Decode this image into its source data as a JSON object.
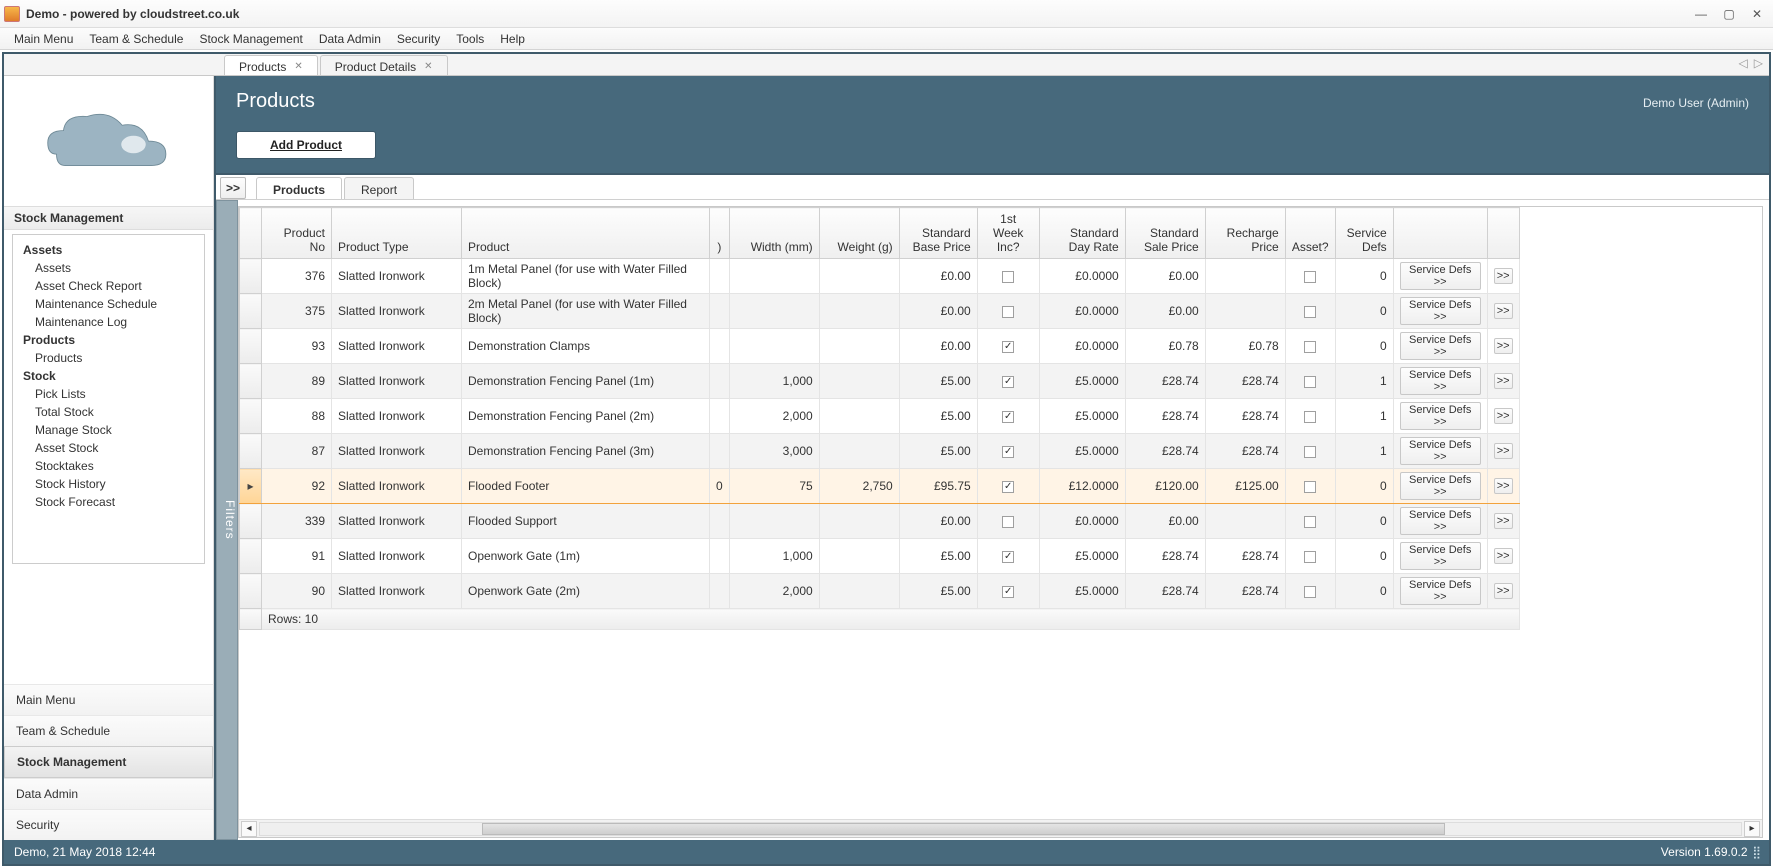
{
  "window": {
    "title": "Demo - powered by cloudstreet.co.uk"
  },
  "menubar": [
    "Main Menu",
    "Team & Schedule",
    "Stock Management",
    "Data Admin",
    "Security",
    "Tools",
    "Help"
  ],
  "tabs": [
    {
      "label": "Products",
      "active": true
    },
    {
      "label": "Product Details",
      "active": false
    }
  ],
  "page": {
    "title": "Products",
    "user": "Demo User (Admin)",
    "add_label": "Add Product"
  },
  "sidebar": {
    "section_title": "Stock Management",
    "groups": [
      {
        "cat": "Assets",
        "items": [
          "Assets",
          "Asset Check Report",
          "Maintenance Schedule",
          "Maintenance Log"
        ]
      },
      {
        "cat": "Products",
        "items": [
          "Products"
        ]
      },
      {
        "cat": "Stock",
        "items": [
          "Pick Lists",
          "Total Stock",
          "Manage Stock",
          "Asset Stock",
          "Stocktakes",
          "Stock History",
          "Stock Forecast"
        ]
      }
    ],
    "navbuttons": [
      "Main Menu",
      "Team & Schedule",
      "Stock Management",
      "Data Admin",
      "Security"
    ],
    "active_nav": "Stock Management"
  },
  "subtabs": [
    {
      "label": "Products",
      "active": true
    },
    {
      "label": "Report",
      "active": false
    }
  ],
  "expand_label": ">>",
  "filters_label": "Filters",
  "grid": {
    "columns": [
      "Product No",
      "Product Type",
      "Product",
      ")",
      "Width (mm)",
      "Weight (g)",
      "Standard Base Price",
      "1st Week Inc?",
      "Standard Day Rate",
      "Standard Sale Price",
      "Recharge Price",
      "Asset?",
      "Service Defs",
      "",
      ""
    ],
    "service_btn_label": "Service Defs >>",
    "more_btn_label": ">>",
    "rows": [
      {
        "no": "376",
        "type": "Slatted Ironwork",
        "product": "1m Metal Panel (for use with Water Filled Block)",
        "paren": "",
        "width": "",
        "weight": "",
        "base": "£0.00",
        "inc": false,
        "day": "£0.0000",
        "sale": "£0.00",
        "recharge": "",
        "asset": false,
        "defs": "0"
      },
      {
        "no": "375",
        "type": "Slatted Ironwork",
        "product": "2m Metal Panel (for use with Water Filled Block)",
        "paren": "",
        "width": "",
        "weight": "",
        "base": "£0.00",
        "inc": false,
        "day": "£0.0000",
        "sale": "£0.00",
        "recharge": "",
        "asset": false,
        "defs": "0"
      },
      {
        "no": "93",
        "type": "Slatted Ironwork",
        "product": "Demonstration Clamps",
        "paren": "",
        "width": "",
        "weight": "",
        "base": "£0.00",
        "inc": true,
        "day": "£0.0000",
        "sale": "£0.78",
        "recharge": "£0.78",
        "asset": false,
        "defs": "0"
      },
      {
        "no": "89",
        "type": "Slatted Ironwork",
        "product": "Demonstration Fencing Panel (1m)",
        "paren": "",
        "width": "1,000",
        "weight": "",
        "base": "£5.00",
        "inc": true,
        "day": "£5.0000",
        "sale": "£28.74",
        "recharge": "£28.74",
        "asset": false,
        "defs": "1"
      },
      {
        "no": "88",
        "type": "Slatted Ironwork",
        "product": "Demonstration Fencing Panel (2m)",
        "paren": "",
        "width": "2,000",
        "weight": "",
        "base": "£5.00",
        "inc": true,
        "day": "£5.0000",
        "sale": "£28.74",
        "recharge": "£28.74",
        "asset": false,
        "defs": "1"
      },
      {
        "no": "87",
        "type": "Slatted Ironwork",
        "product": "Demonstration Fencing Panel (3m)",
        "paren": "",
        "width": "3,000",
        "weight": "",
        "base": "£5.00",
        "inc": true,
        "day": "£5.0000",
        "sale": "£28.74",
        "recharge": "£28.74",
        "asset": false,
        "defs": "1"
      },
      {
        "no": "92",
        "type": "Slatted Ironwork",
        "product": "Flooded Footer",
        "paren": "0",
        "width": "75",
        "weight": "2,750",
        "base": "£95.75",
        "inc": true,
        "day": "£12.0000",
        "sale": "£120.00",
        "recharge": "£125.00",
        "asset": false,
        "defs": "0",
        "selected": true
      },
      {
        "no": "339",
        "type": "Slatted Ironwork",
        "product": "Flooded Support",
        "paren": "",
        "width": "",
        "weight": "",
        "base": "£0.00",
        "inc": false,
        "day": "£0.0000",
        "sale": "£0.00",
        "recharge": "",
        "asset": false,
        "defs": "0"
      },
      {
        "no": "91",
        "type": "Slatted Ironwork",
        "product": "Openwork Gate (1m)",
        "paren": "",
        "width": "1,000",
        "weight": "",
        "base": "£5.00",
        "inc": true,
        "day": "£5.0000",
        "sale": "£28.74",
        "recharge": "£28.74",
        "asset": false,
        "defs": "0"
      },
      {
        "no": "90",
        "type": "Slatted Ironwork",
        "product": "Openwork Gate (2m)",
        "paren": "",
        "width": "2,000",
        "weight": "",
        "base": "£5.00",
        "inc": true,
        "day": "£5.0000",
        "sale": "£28.74",
        "recharge": "£28.74",
        "asset": false,
        "defs": "0"
      }
    ],
    "row_count_label": "Rows: 10"
  },
  "statusbar": {
    "left": "Demo, 21 May 2018 12:44",
    "right": "Version 1.69.0.2"
  }
}
